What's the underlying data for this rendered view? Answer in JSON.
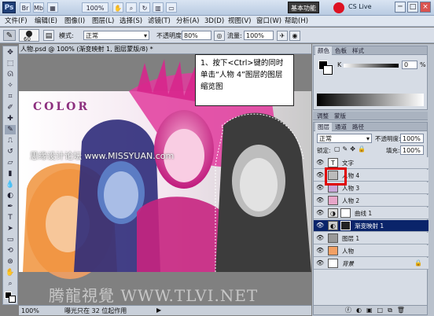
{
  "window": {
    "ps_logo": "Ps",
    "zoom": "100%",
    "workspace": "基本功能",
    "cs_live": "CS Live",
    "controls": [
      "─",
      "□",
      "×"
    ]
  },
  "menu": [
    "文件(F)",
    "编辑(E)",
    "图像(I)",
    "图层(L)",
    "选择(S)",
    "滤镜(T)",
    "分析(A)",
    "3D(D)",
    "视图(V)",
    "窗口(W)",
    "帮助(H)"
  ],
  "options": {
    "brush_size": "60",
    "mode_label": "模式:",
    "mode_value": "正常",
    "opacity_label": "不透明度:",
    "opacity_value": "80%",
    "flow_label": "流量:",
    "flow_value": "100%"
  },
  "doc_tab": "人物.psd @ 100% (渐变映射 1, 图层蒙版/8) *",
  "canvas": {
    "color_text": "COLOR",
    "watermark_small": "思缘设计论坛 www.MISSYUAN.com",
    "watermark_big": "腾龍視覺 WWW.TLVI.NET"
  },
  "callout": "1、按下<Ctrl>键的同时单击“人物 4”图层的图层缩览图",
  "status": {
    "zoom": "100%",
    "text": "曝光只在 32 位起作用"
  },
  "color_panel": {
    "tabs": [
      "颜色",
      "色板",
      "样式"
    ],
    "k_label": "K",
    "k_value": "0",
    "k_unit": "%"
  },
  "adjust_tabs": [
    "调整",
    "蒙版"
  ],
  "layers_panel": {
    "tabs": [
      "图层",
      "通道",
      "路径"
    ],
    "blend_mode": "正常",
    "opacity_label": "不透明度:",
    "opacity_value": "100%",
    "lock_label": "锁定:",
    "fill_label": "填充:",
    "fill_value": "100%",
    "layers": [
      {
        "name": "文字",
        "kind": "text"
      },
      {
        "name": "人物 4",
        "kind": "image"
      },
      {
        "name": "人物 3",
        "kind": "image"
      },
      {
        "name": "人物 2",
        "kind": "image"
      },
      {
        "name": "曲线 1",
        "kind": "adjust"
      },
      {
        "name": "渐变映射 1",
        "kind": "adjust",
        "selected": true
      },
      {
        "name": "图层 1",
        "kind": "image"
      },
      {
        "name": "人物",
        "kind": "image"
      },
      {
        "name": "背景",
        "kind": "bg"
      }
    ]
  },
  "colors": {
    "selection": "#0a246a",
    "highlight_box": "#e00000"
  }
}
